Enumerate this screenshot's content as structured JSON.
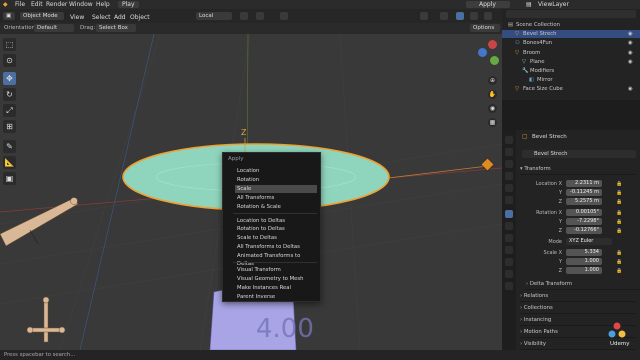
{
  "menu": {
    "items": [
      "File",
      "Edit",
      "Render",
      "Window",
      "Help"
    ],
    "tab": "Play",
    "apply": "Apply",
    "view_layer": "ViewLayer"
  },
  "header": {
    "mode": "Object Mode",
    "view": "View",
    "select": "Select",
    "add": "Add",
    "object": "Object",
    "transform": "Local"
  },
  "header2": {
    "orientation_label": "Orientation:",
    "orientation": "Default",
    "drag_label": "Drag:",
    "drag": "Select Box",
    "options": "Options"
  },
  "viewport": {
    "axis_label": "Z"
  },
  "context_menu": {
    "title": "Apply",
    "groups": [
      [
        "Location",
        "Rotation",
        "Scale",
        "All Transforms",
        "Rotation & Scale"
      ],
      [
        "Location to Deltas",
        "Rotation to Deltas",
        "Scale to Deltas",
        "All Transforms to Deltas",
        "Animated Transforms to Deltas"
      ],
      [
        "Visual Transform",
        "Visual Geometry to Mesh",
        "Make Instances Real",
        "Parent Inverse"
      ]
    ],
    "highlighted": "Scale"
  },
  "outliner": {
    "rows": [
      "Scene Collection",
      "Bevel Strech",
      "Bones4Fun",
      "Broom",
      "Plane",
      "Modifiers",
      "Mirror",
      "Face Size Cube"
    ],
    "selected": "Bevel Strech"
  },
  "properties": {
    "object_name": "Bevel Strech",
    "object_name_field": "Bevel Strech",
    "transform_label": "Transform",
    "location": {
      "label": "Location X",
      "x": "2.2311 m",
      "y": "-0.11245 m",
      "z": "5.2575 m"
    },
    "rotation": {
      "label": "Rotation X",
      "x": "0.00105°",
      "y": "-7.2298°",
      "z": "-0.12766°"
    },
    "mode_label": "Mode",
    "mode": "XYZ Euler",
    "scale": {
      "label": "Scale X",
      "x": "5.334",
      "y": "1.000",
      "z": "1.000"
    },
    "axis_y": "Y",
    "axis_z": "Z",
    "sections": [
      "Delta Transform",
      "Relations",
      "Collections",
      "Instancing",
      "Motion Paths",
      "Visibility"
    ]
  },
  "status": {
    "text": "Press spacebar to search..."
  },
  "watermark": {
    "text": "Udemy"
  },
  "colors": {
    "accent": "#4a6fa0",
    "selection": "#334d80",
    "mesh": "#8fd4bc",
    "outline": "#f0a030"
  }
}
